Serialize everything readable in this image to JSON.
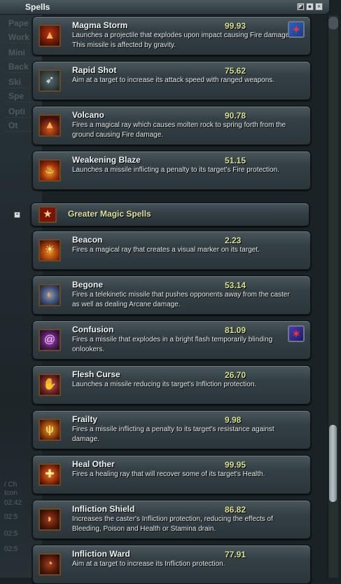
{
  "window": {
    "title": "Spells"
  },
  "background": {
    "tabs": [
      "Pape",
      "Work",
      "Mini",
      "Back",
      "Ski",
      "Spe",
      "Opti",
      "Ot"
    ],
    "log": [
      "/ Ch",
      "Icon",
      "02:42",
      "02:5",
      "02:5",
      "02:5"
    ]
  },
  "spells_top": [
    {
      "name": "Magma Storm",
      "value": "99.93",
      "description": "Launches a projectile that explodes upon impact causing Fire damage. This missile is affected by gravity.",
      "icon": "magma-icon",
      "badge": true
    },
    {
      "name": "Rapid Shot",
      "value": "75.62",
      "description": "Aim at a target to increase its attack speed with ranged weapons.",
      "icon": "arrow-icon",
      "badge": false
    },
    {
      "name": "Volcano",
      "value": "90.78",
      "description": "Fires a magical ray which causes molten rock to spring forth from the ground causing Fire damage.",
      "icon": "volcano-icon",
      "badge": false
    },
    {
      "name": "Weakening Blaze",
      "value": "51.15",
      "description": "Launches a missile inflicting a penalty to its target's Fire protection.",
      "icon": "flame-icon",
      "badge": false
    }
  ],
  "section": {
    "title": "Greater Magic Spells",
    "icon": "star-icon",
    "collapse_symbol": "-"
  },
  "spells_bottom": [
    {
      "name": "Beacon",
      "value": "2.23",
      "description": "Fires a magical ray that creates a visual marker on its target.",
      "icon": "beacon-icon",
      "badge": false
    },
    {
      "name": "Begone",
      "value": "53.14",
      "description": "Fires a telekinetic missile that pushes opponents away from the caster as well as dealing Arcane damage.",
      "icon": "push-icon",
      "badge": false
    },
    {
      "name": "Confusion",
      "value": "81.09",
      "description": "Fires a missile that explodes in a bright flash temporarily blinding onlookers.",
      "icon": "swirl-icon",
      "badge": true
    },
    {
      "name": "Flesh Curse",
      "value": "26.70",
      "description": "Launches a missile reducing its target's Infliction protection.",
      "icon": "hand-icon",
      "badge": false
    },
    {
      "name": "Frailty",
      "value": "9.98",
      "description": "Fires a missile inflicting a penalty to its target's resistance against damage.",
      "icon": "frailty-icon",
      "badge": false
    },
    {
      "name": "Heal Other",
      "value": "99.95",
      "description": "Fires a healing ray that will recover some of its target's Health.",
      "icon": "heal-icon",
      "badge": false
    },
    {
      "name": "Infliction Shield",
      "value": "86.82",
      "description": "Increases the caster's Infliction protection, reducing the effects of Bleeding, Poison and Health or Stamina drain.",
      "icon": "shield-icon",
      "badge": false
    },
    {
      "name": "Infliction Ward",
      "value": "77.91",
      "description": "Aim at a target to increase its Infliction protection.",
      "icon": "ward-icon",
      "badge": false
    }
  ],
  "colors": {
    "value": "#d8e08a",
    "section_title": "#dfe49a",
    "card": "#344046"
  }
}
